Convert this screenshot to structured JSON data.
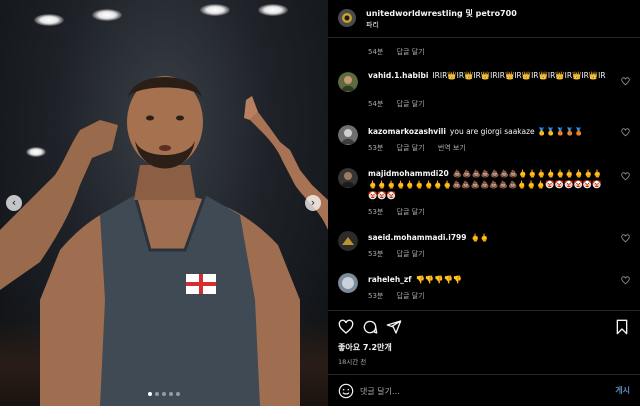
{
  "post": {
    "owner": "unitedworldwrestling",
    "coauthor_sep": "및",
    "coauthor": "petro700",
    "location": "파리"
  },
  "comments": [
    {
      "user": "",
      "text": "",
      "time": "54분",
      "reply": "답글 달기",
      "extra": ""
    },
    {
      "user": "vahid.1.habibi",
      "text": "IRIR👑IR👑IR👑IRIR👑IR👑IR👑IR👑IR👑IR👑IR",
      "time": "54분",
      "reply": "답글 달기",
      "extra": ""
    },
    {
      "user": "kazomarkozashvili",
      "text": "you are giorgi saakaze 🥇🥇🥉🥉🥉",
      "time": "53분",
      "reply": "답글 달기",
      "extra": "번역 보기"
    },
    {
      "user": "majidmohammdi20",
      "text": "💩💩💩💩💩💩💩🖕🖕🖕🖕🖕🖕🖕🖕🖕🖕🖕🖕🖕🖕🖕🖕🖕🖕💩💩💩💩💩💩💩🖕🖕🖕🤡🤡🤡🤡🤡🤡🤡🤡🤡",
      "time": "53분",
      "reply": "답글 달기",
      "extra": ""
    },
    {
      "user": "saeid.mohammadi.i799",
      "text": "🖕🖕",
      "time": "53분",
      "reply": "답글 달기",
      "extra": ""
    },
    {
      "user": "raheleh_zf",
      "text": "👎👎👎👎👎",
      "time": "53분",
      "reply": "답글 달기",
      "extra": ""
    }
  ],
  "engagement": {
    "likes_label": "좋아요 7.2만개",
    "posted_ago": "18시간 전"
  },
  "composer": {
    "placeholder": "댓글 달기...",
    "post_label": "게시"
  },
  "icons": [
    "heart-icon",
    "comment-icon",
    "share-icon",
    "bookmark-icon",
    "emoji-icon",
    "chevron-left-icon",
    "chevron-right-icon"
  ],
  "colors": {
    "background": "#000000",
    "muted_text": "#a8a8a8",
    "divider": "#262626",
    "link": "#5c8cbd"
  }
}
